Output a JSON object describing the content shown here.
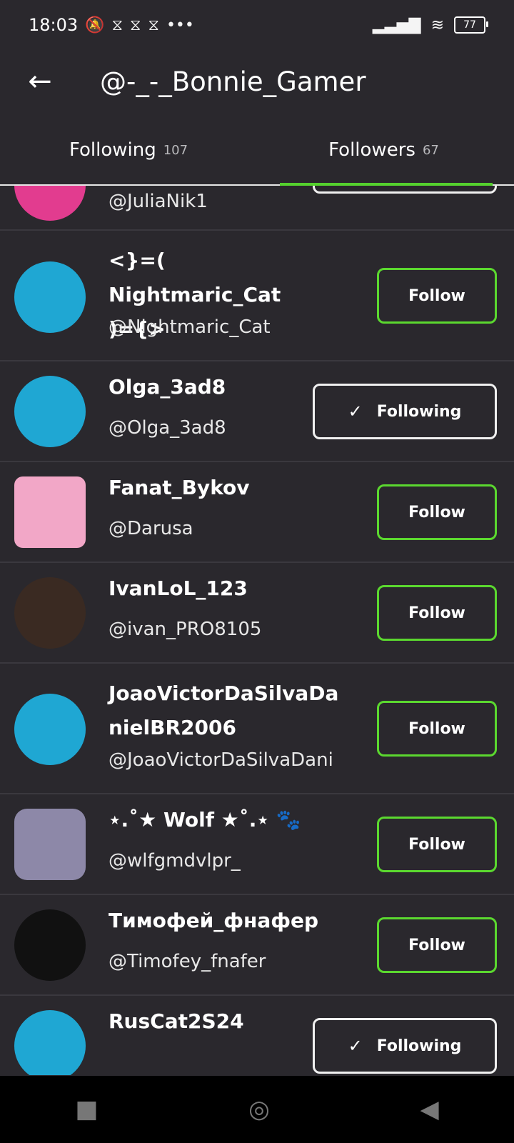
{
  "status": {
    "time": "18:03",
    "battery": "77"
  },
  "header": {
    "title": "@-_-_Bonnie_Gamer"
  },
  "tabs": [
    {
      "label": "Following",
      "count": "107"
    },
    {
      "label": "Followers",
      "count": "67"
    }
  ],
  "users": [
    {
      "name": "",
      "handle": "@JuliaNik1",
      "button": ""
    },
    {
      "name": "<}=( Nightmaric_Cat\n)={>",
      "handle": "@Nightmaric_Cat",
      "button": "Follow"
    },
    {
      "name": "Olga_3ad8",
      "handle": "@Olga_3ad8",
      "button": "Following"
    },
    {
      "name": "Fanat_Bykov",
      "handle": "@Darusa",
      "button": "Follow"
    },
    {
      "name": "IvanLoL_123",
      "handle": "@ivan_PRO8105",
      "button": "Follow"
    },
    {
      "name": "JoaoVictorDaSilvaDa\nnielBR2006",
      "handle": "@JoaoVictorDaSilvaDani",
      "button": "Follow"
    },
    {
      "name": "⋆.˚★ Wolf ★˚.⋆ 🐾",
      "handle": "@wlfgmdvlpr_",
      "button": "Follow"
    },
    {
      "name": "Тимофей_фнафер",
      "handle": "@Timofey_fnafer",
      "button": "Follow"
    },
    {
      "name": "RusCat2S24",
      "handle": "",
      "button": "Following"
    }
  ],
  "icons": {
    "back": "←",
    "check": "✓",
    "nav_square": "■",
    "nav_circle": "◎",
    "nav_back": "◀"
  }
}
